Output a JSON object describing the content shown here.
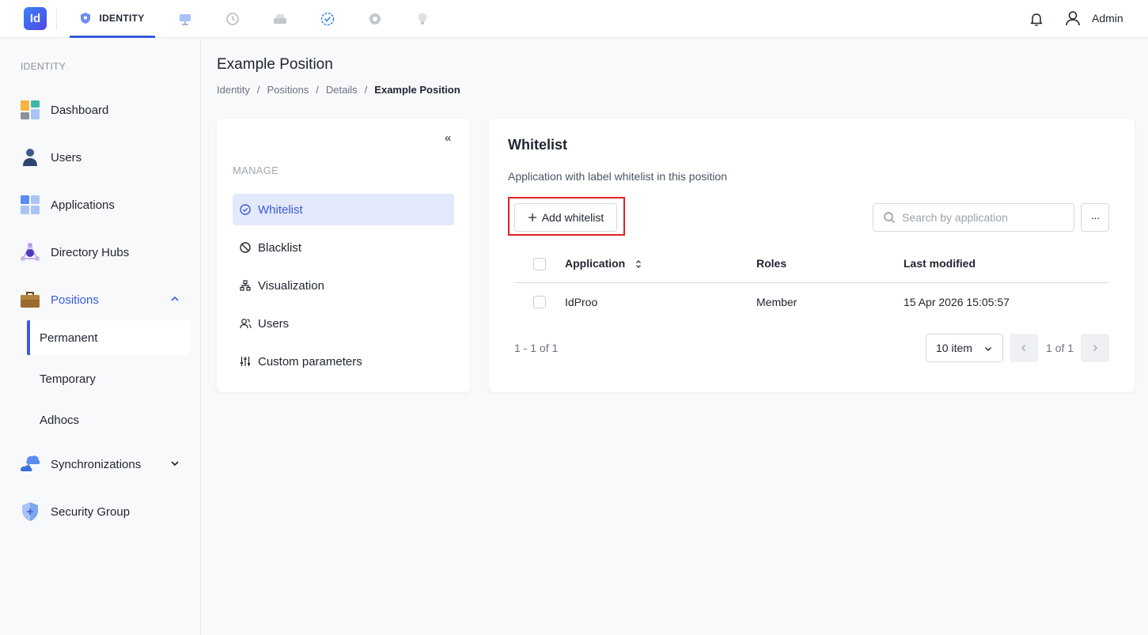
{
  "topbar": {
    "logo_text": "Id",
    "active_module": "IDENTITY",
    "modules": [
      "monitor-icon",
      "history-icon",
      "drive-icon",
      "check-badge-icon",
      "settings-icon",
      "lightbulb-icon"
    ],
    "user_name": "Admin"
  },
  "sidebar": {
    "section_title": "IDENTITY",
    "items": [
      {
        "label": "Dashboard",
        "icon": "dashboard-icon"
      },
      {
        "label": "Users",
        "icon": "user-icon"
      },
      {
        "label": "Applications",
        "icon": "applications-icon"
      },
      {
        "label": "Directory Hubs",
        "icon": "directory-hubs-icon"
      },
      {
        "label": "Positions",
        "icon": "briefcase-icon"
      },
      {
        "label": "Synchronizations",
        "icon": "cloud-sync-icon"
      },
      {
        "label": "Security Group",
        "icon": "shield-icon"
      }
    ],
    "sub_items": [
      {
        "label": "Permanent"
      },
      {
        "label": "Temporary"
      },
      {
        "label": "Adhocs"
      }
    ]
  },
  "page": {
    "title": "Example Position",
    "breadcrumb": [
      "Identity",
      "Positions",
      "Details",
      "Example Position"
    ]
  },
  "manage": {
    "collapse_label": "«",
    "title": "MANAGE",
    "items": [
      {
        "label": "Whitelist",
        "icon": "check-circle-icon"
      },
      {
        "label": "Blacklist",
        "icon": "ban-icon"
      },
      {
        "label": "Visualization",
        "icon": "hierarchy-icon"
      },
      {
        "label": "Users",
        "icon": "users-icon"
      },
      {
        "label": "Custom parameters",
        "icon": "sliders-icon"
      }
    ]
  },
  "whitelist": {
    "title": "Whitelist",
    "description": "Application with label whitelist in this position",
    "add_label": "Add whitelist",
    "search_placeholder": "Search by application",
    "more_label": "···",
    "columns": [
      "Application",
      "Roles",
      "Last modified"
    ],
    "rows": [
      {
        "application": "IdProo",
        "roles": "Member",
        "last_modified": "15 Apr 2026 15:05:57"
      }
    ],
    "range_text": "1 - 1 of 1",
    "per_page": "10 item",
    "page_text": "1 of 1"
  },
  "colors": {
    "accent": "#3b5bdb",
    "highlight_border": "#e02424",
    "active_bg": "#e4e8fb"
  }
}
